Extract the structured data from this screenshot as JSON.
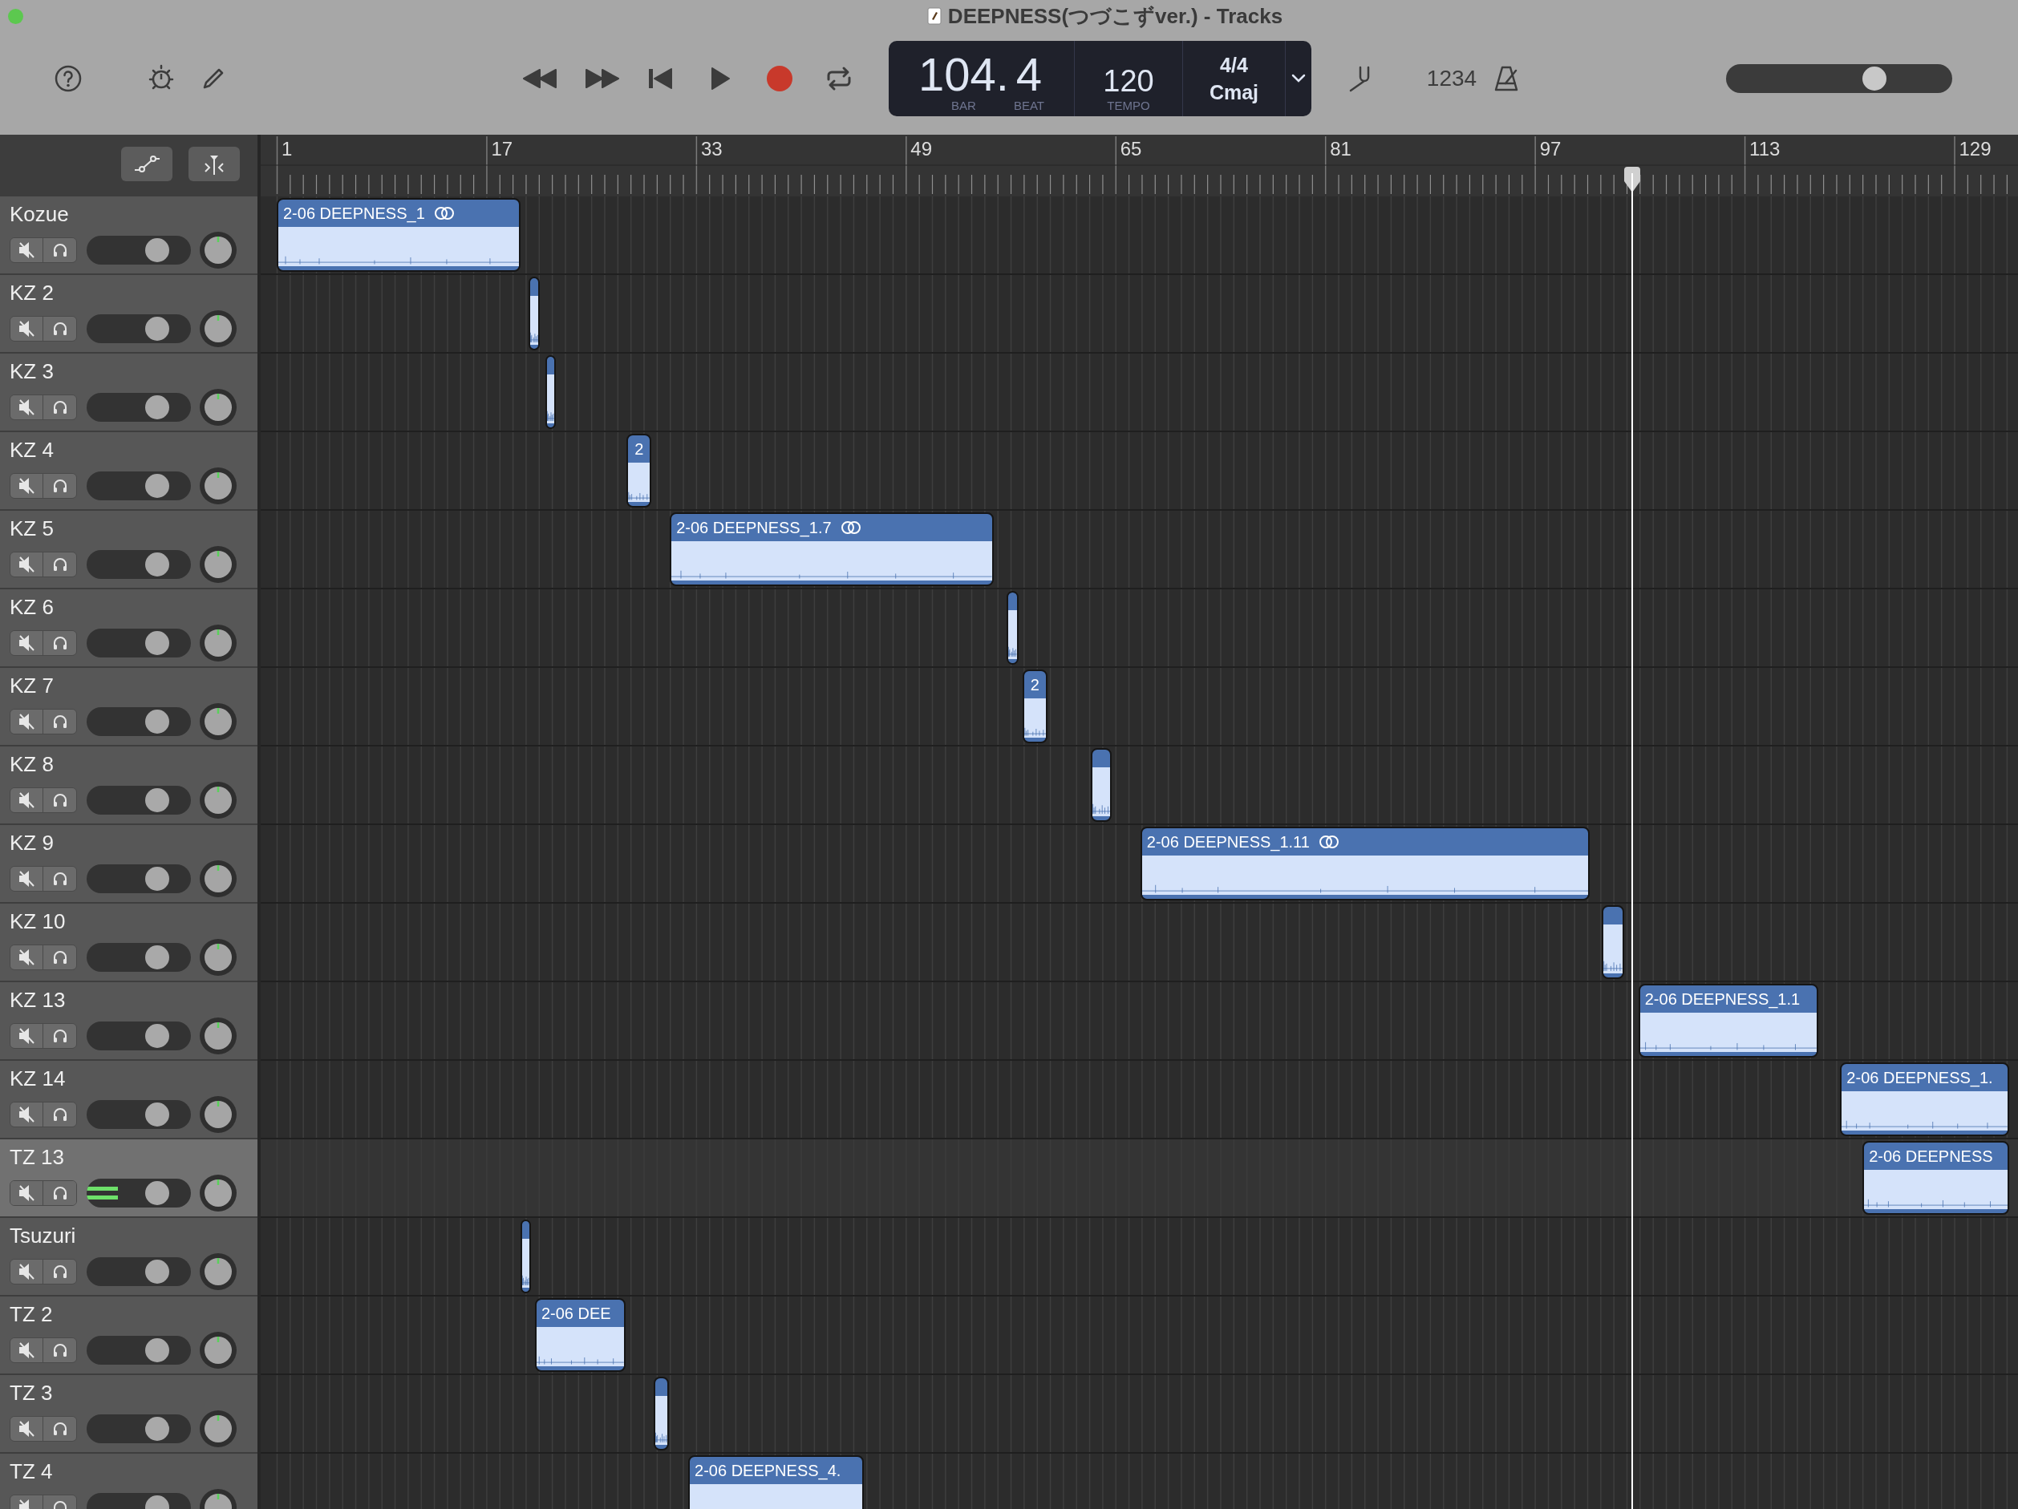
{
  "window": {
    "title": "DEEPNESS(つづこずver.) - Tracks"
  },
  "toolbar": {
    "lcd": {
      "bar": "104.",
      "bar_label": "BAR",
      "beat": "4",
      "beat_label": "BEAT",
      "tempo": "120",
      "tempo_label": "TEMPO",
      "time_signature": "4/4",
      "key": "Cmaj"
    },
    "count_in": "1234",
    "master_volume": {
      "level": 0.68
    }
  },
  "ruler": {
    "bars": [
      "1",
      "17",
      "33",
      "49",
      "65",
      "81",
      "97",
      "113",
      "129"
    ]
  },
  "tracks": [
    {
      "name": "Kozue",
      "selected": false,
      "muted": false,
      "soloed": false,
      "volume": {
        "level": 0.74
      },
      "meter": {
        "level": 0
      },
      "regions": [
        {
          "label": "2-06 DEEPNESS_1",
          "linked": true
        }
      ]
    },
    {
      "name": "KZ 2",
      "selected": false,
      "muted": false,
      "soloed": false,
      "volume": {
        "level": 0.74
      },
      "meter": {
        "level": 0
      },
      "regions": [
        {
          "linked": false
        }
      ]
    },
    {
      "name": "KZ 3",
      "selected": false,
      "muted": false,
      "soloed": false,
      "volume": {
        "level": 0.74
      },
      "meter": {
        "level": 0
      },
      "regions": [
        {
          "linked": false
        }
      ]
    },
    {
      "name": "KZ 4",
      "selected": false,
      "muted": false,
      "soloed": false,
      "volume": {
        "level": 0.74
      },
      "meter": {
        "level": 0
      },
      "regions": [
        {
          "label": "2",
          "linked": false
        }
      ]
    },
    {
      "name": "KZ 5",
      "selected": false,
      "muted": false,
      "soloed": false,
      "volume": {
        "level": 0.74
      },
      "meter": {
        "level": 0
      },
      "regions": [
        {
          "label": "2-06 DEEPNESS_1.7",
          "linked": true
        }
      ]
    },
    {
      "name": "KZ 6",
      "selected": false,
      "muted": false,
      "soloed": false,
      "volume": {
        "level": 0.74
      },
      "meter": {
        "level": 0
      },
      "regions": [
        {
          "linked": false
        }
      ]
    },
    {
      "name": "KZ 7",
      "selected": false,
      "muted": false,
      "soloed": false,
      "volume": {
        "level": 0.74
      },
      "meter": {
        "level": 0
      },
      "regions": [
        {
          "label": "2",
          "linked": false
        }
      ]
    },
    {
      "name": "KZ 8",
      "selected": false,
      "muted": false,
      "soloed": false,
      "volume": {
        "level": 0.74
      },
      "meter": {
        "level": 0
      },
      "regions": [
        {
          "linked": false
        }
      ]
    },
    {
      "name": "KZ 9",
      "selected": false,
      "muted": false,
      "soloed": false,
      "volume": {
        "level": 0.74
      },
      "meter": {
        "level": 0
      },
      "regions": [
        {
          "label": "2-06 DEEPNESS_1.11",
          "linked": true
        }
      ]
    },
    {
      "name": "KZ 10",
      "selected": false,
      "muted": false,
      "soloed": false,
      "volume": {
        "level": 0.74
      },
      "meter": {
        "level": 0
      },
      "regions": [
        {
          "linked": false
        }
      ]
    },
    {
      "name": "KZ 13",
      "selected": false,
      "muted": false,
      "soloed": false,
      "volume": {
        "level": 0.74
      },
      "meter": {
        "level": 0
      },
      "regions": [
        {
          "label": "2-06 DEEPNESS_1.1",
          "linked": false
        }
      ]
    },
    {
      "name": "KZ 14",
      "selected": false,
      "muted": false,
      "soloed": false,
      "volume": {
        "level": 0.74
      },
      "meter": {
        "level": 0
      },
      "regions": [
        {
          "label": "2-06 DEEPNESS_1.",
          "linked": false
        }
      ]
    },
    {
      "name": "TZ 13",
      "selected": true,
      "muted": false,
      "soloed": false,
      "volume": {
        "level": 0.74
      },
      "meter": {
        "level": 0.3
      },
      "regions": [
        {
          "label": "2-06 DEEPNESS",
          "linked": false
        }
      ]
    },
    {
      "name": "Tsuzuri",
      "selected": false,
      "muted": false,
      "soloed": false,
      "volume": {
        "level": 0.74
      },
      "meter": {
        "level": 0
      },
      "regions": [
        {
          "linked": false
        }
      ]
    },
    {
      "name": "TZ 2",
      "selected": false,
      "muted": false,
      "soloed": false,
      "volume": {
        "level": 0.74
      },
      "meter": {
        "level": 0
      },
      "regions": [
        {
          "label": "2-06 DEE",
          "linked": false
        }
      ]
    },
    {
      "name": "TZ 3",
      "selected": false,
      "muted": false,
      "soloed": false,
      "volume": {
        "level": 0.74
      },
      "meter": {
        "level": 0
      },
      "regions": [
        {
          "linked": false
        }
      ]
    },
    {
      "name": "TZ 4",
      "selected": false,
      "muted": false,
      "soloed": false,
      "volume": {
        "level": 0.74
      },
      "meter": {
        "level": 0
      },
      "regions": [
        {
          "label": "2-06 DEEPNESS_4.",
          "linked": false
        }
      ]
    }
  ]
}
